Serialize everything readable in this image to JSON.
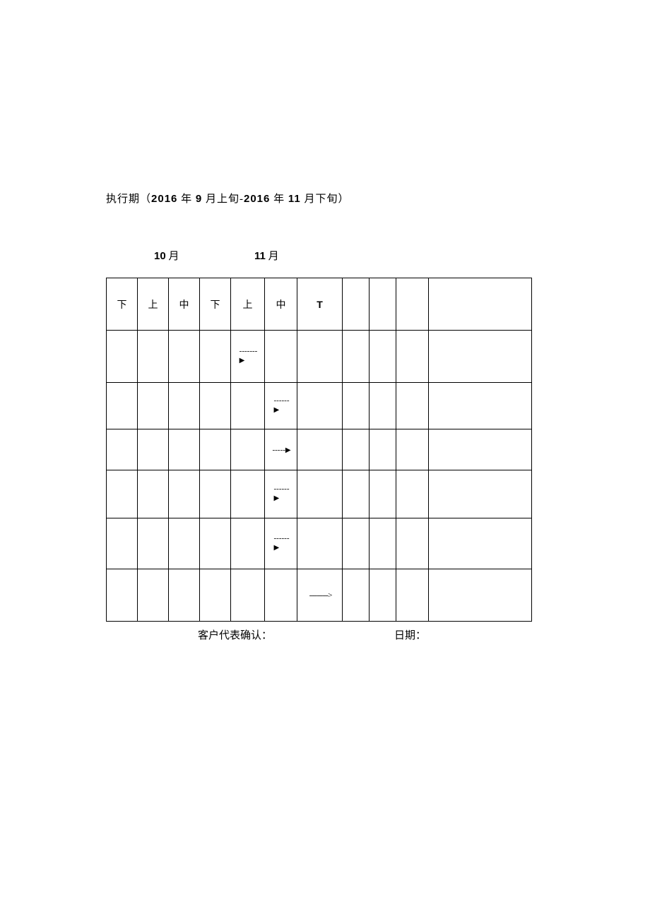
{
  "title": {
    "prefix": "执行期（",
    "year1": "2016",
    "mid1": " 年 ",
    "month1": "9",
    "mid2": " 月上旬-",
    "year2": "2016",
    "mid3": " 年 ",
    "month2": "11",
    "suffix": " 月下旬）"
  },
  "months": {
    "m10_num": "10",
    "m10_suf": " 月",
    "m11_num": "11",
    "m11_suf": " 月"
  },
  "headers": [
    "下",
    "上",
    "中",
    "下",
    "上",
    "中",
    "T",
    "",
    "",
    "",
    ""
  ],
  "rows": [
    {
      "arrowCol": 4,
      "style": "dash-tri"
    },
    {
      "arrowCol": 5,
      "style": "dash-tri"
    },
    {
      "arrowCol": 5,
      "style": "dash-tri-inline"
    },
    {
      "arrowCol": 5,
      "style": "dash-tri"
    },
    {
      "arrowCol": 5,
      "style": "dash-tri"
    },
    {
      "arrowCol": 6,
      "style": "dash-gt"
    }
  ],
  "arrow_glyphs": {
    "dashes": "-------",
    "dashes_short": "------",
    "dashes_inline": "-----",
    "tri": "▶",
    "dashes_long": "----------",
    "gt": ">"
  },
  "footer": {
    "confirm": "客户代表确认：",
    "date": "日期："
  }
}
